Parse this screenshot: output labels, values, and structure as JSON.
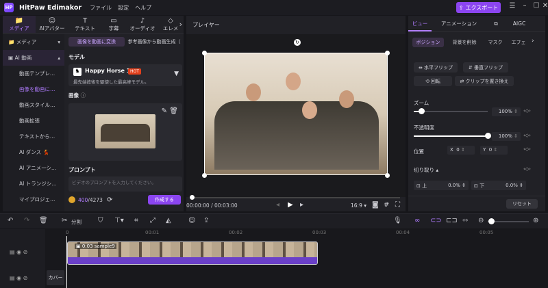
{
  "app": {
    "title": "HitPaw Edimakor",
    "menu": [
      "ファイル",
      "設定",
      "ヘルプ"
    ],
    "export_label": "エクスポート"
  },
  "left": {
    "tabs": [
      {
        "label": "メディア",
        "icon": "folder-icon"
      },
      {
        "label": "AIアバター",
        "icon": "avatar-icon"
      },
      {
        "label": "テキスト",
        "icon": "text-icon"
      },
      {
        "label": "字幕",
        "icon": "subtitle-icon"
      },
      {
        "label": "オーディオ",
        "icon": "music-icon"
      },
      {
        "label": "エレメ",
        "icon": "element-icon"
      }
    ],
    "sidebar": [
      {
        "label": "メディア",
        "header": true
      },
      {
        "label": "AI 動画",
        "header": true
      },
      {
        "label": "動画テンプレ…"
      },
      {
        "label": "画像を動画に…",
        "selected": true
      },
      {
        "label": "動画スタイル…"
      },
      {
        "label": "動画拡張"
      },
      {
        "label": "テキストから…"
      },
      {
        "label": "AI ダンス 💃"
      },
      {
        "label": "AI アニメーシ…"
      },
      {
        "label": "AI トランジシ…"
      },
      {
        "label": "マイプロジェ…"
      }
    ],
    "subtabs": [
      "画像を動画に変換",
      "参考画像から動画生成（"
    ],
    "model_label": "モデル",
    "model_name": "Happy Horse 1.0",
    "model_badge": "HOT",
    "model_desc": "最先端技術を駆使した最高峰モデル。",
    "image_label": "画像",
    "prompt_label": "プロンプト",
    "prompt_placeholder": "ビデオのプロンプトを入力してください。",
    "credits_used": "400",
    "credits_total": "/4273",
    "create_label": "作成する"
  },
  "player": {
    "title": "プレイヤー",
    "time_current": "00:00:00",
    "time_sep": " / ",
    "time_total": "00:03:00",
    "ratio": "16:9",
    "progress": 0.0
  },
  "right": {
    "tabs": [
      "ビュー",
      "アニメーション",
      "AIGC"
    ],
    "subtabs": [
      "ポジション",
      "背景を削除",
      "マスク",
      "エフェ"
    ],
    "buttons": [
      "水平フリップ",
      "垂直フリップ",
      "回転",
      "クリップを置き換え"
    ],
    "zoom_label": "ズーム",
    "zoom_value": "100%",
    "zoom_level": 0.1,
    "opacity_label": "不透明度",
    "opacity_value": "100%",
    "opacity_level": 1.0,
    "position_label": "位置",
    "x_label": "X",
    "x_value": "0",
    "y_label": "Y",
    "y_value": "0",
    "crop_label": "切り取り",
    "crop_top_label": "上",
    "crop_top_value": "0.0%",
    "crop_bottom_label": "下",
    "crop_bottom_value": "0.0%",
    "reset_label": "リセット"
  },
  "timeline": {
    "split_label": "分割",
    "ruler": [
      "0",
      "00:01",
      "00:02",
      "00:03",
      "00:04",
      "00:05"
    ],
    "clip_label": "0:03 sample9",
    "cover_label": "カバー"
  },
  "colors": {
    "accent": "#8b45f0",
    "accent_text": "#b07cff",
    "clip_bar": "#6a40c8"
  }
}
